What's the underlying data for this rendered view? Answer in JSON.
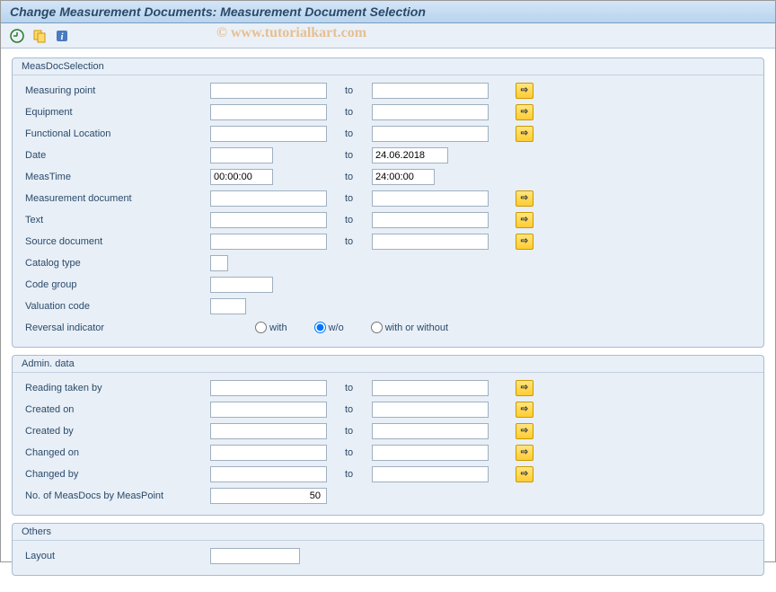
{
  "title": "Change Measurement Documents: Measurement Document Selection",
  "watermark": "© www.tutorialkart.com",
  "toolbar": {
    "execute": "execute",
    "variant": "variant",
    "info": "info"
  },
  "groups": {
    "measdoc": {
      "header": "MeasDocSelection",
      "rows": {
        "measuring_point": {
          "label": "Measuring point",
          "from": "",
          "to_label": "to",
          "to": "",
          "multi": true
        },
        "equipment": {
          "label": "Equipment",
          "from": "",
          "to_label": "to",
          "to": "",
          "multi": true
        },
        "functional_location": {
          "label": "Functional Location",
          "from": "",
          "to_label": "to",
          "to": "",
          "multi": true
        },
        "date": {
          "label": "Date",
          "from": "",
          "to_label": "to",
          "to": "24.06.2018",
          "multi": false
        },
        "meastime": {
          "label": "MeasTime",
          "from": "00:00:00",
          "to_label": "to",
          "to": "24:00:00",
          "multi": false
        },
        "measurement_document": {
          "label": "Measurement document",
          "from": "",
          "to_label": "to",
          "to": "",
          "multi": true
        },
        "text": {
          "label": "Text",
          "from": "",
          "to_label": "to",
          "to": "",
          "multi": true
        },
        "source_document": {
          "label": "Source document",
          "from": "",
          "to_label": "to",
          "to": "",
          "multi": true
        },
        "catalog_type": {
          "label": "Catalog type",
          "value": ""
        },
        "code_group": {
          "label": "Code group",
          "value": ""
        },
        "valuation_code": {
          "label": "Valuation code",
          "value": ""
        },
        "reversal": {
          "label": "Reversal indicator",
          "options": {
            "with": "with",
            "wo": "w/o",
            "with_or_without": "with or without"
          },
          "selected": "wo"
        }
      }
    },
    "admin": {
      "header": "Admin. data",
      "rows": {
        "reading_taken_by": {
          "label": "Reading taken by",
          "from": "",
          "to_label": "to",
          "to": "",
          "multi": true
        },
        "created_on": {
          "label": "Created on",
          "from": "",
          "to_label": "to",
          "to": "",
          "multi": true
        },
        "created_by": {
          "label": "Created by",
          "from": "",
          "to_label": "to",
          "to": "",
          "multi": true
        },
        "changed_on": {
          "label": "Changed on",
          "from": "",
          "to_label": "to",
          "to": "",
          "multi": true
        },
        "changed_by": {
          "label": "Changed by",
          "from": "",
          "to_label": "to",
          "to": "",
          "multi": true
        },
        "no_measdocs": {
          "label": "No. of MeasDocs by MeasPoint",
          "value": "50"
        }
      }
    },
    "others": {
      "header": "Others",
      "rows": {
        "layout": {
          "label": "Layout",
          "value": ""
        }
      }
    }
  },
  "icons": {
    "arrow": "⇨"
  }
}
